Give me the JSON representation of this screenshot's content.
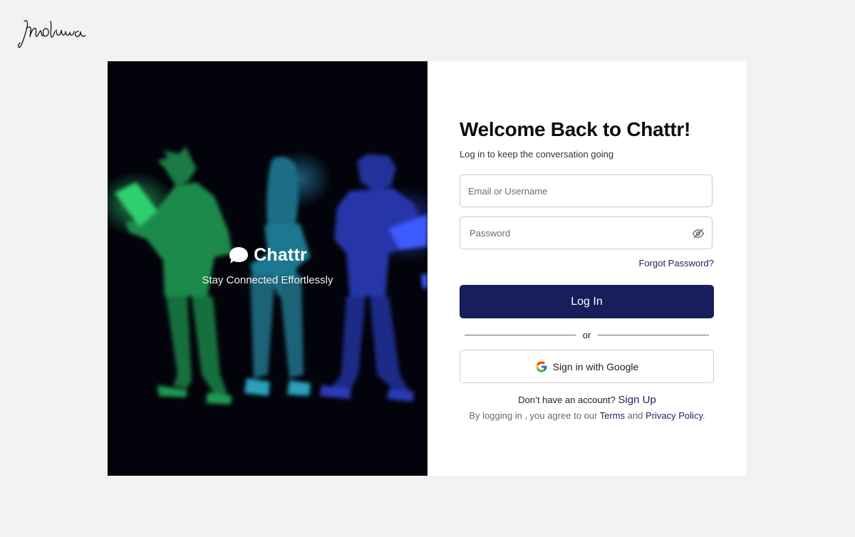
{
  "signature": {
    "text": "Inioluwa"
  },
  "hero": {
    "brand_name": "Chattr",
    "tagline": "Stay Connected Effortlessly",
    "colors": {
      "background": "#03030b",
      "green": "#1fa35a",
      "teal": "#1f7b8f",
      "blue": "#2a36a8"
    }
  },
  "form": {
    "title": "Welcome Back to Chattr!",
    "subtitle": "Log in  to keep the conversation going",
    "email_placeholder": "Email or Username",
    "password_placeholder": "Password",
    "password_toggle_icon": "eye-off-icon",
    "forgot_label": "Forgot Password?",
    "login_label": "Log In",
    "divider_label": "or",
    "google_label": "Sign in with Google",
    "signup_prompt": "Don’t have an account? ",
    "signup_link": "Sign Up",
    "legal_prefix": "By logging in , you agree to our ",
    "terms_link": "Terms",
    "legal_and": " and ",
    "privacy_link": "Privacy Policy",
    "legal_suffix": "."
  },
  "colors": {
    "primary": "#161f5c",
    "link": "#1b2358",
    "page_bg": "#f2f2f2"
  }
}
